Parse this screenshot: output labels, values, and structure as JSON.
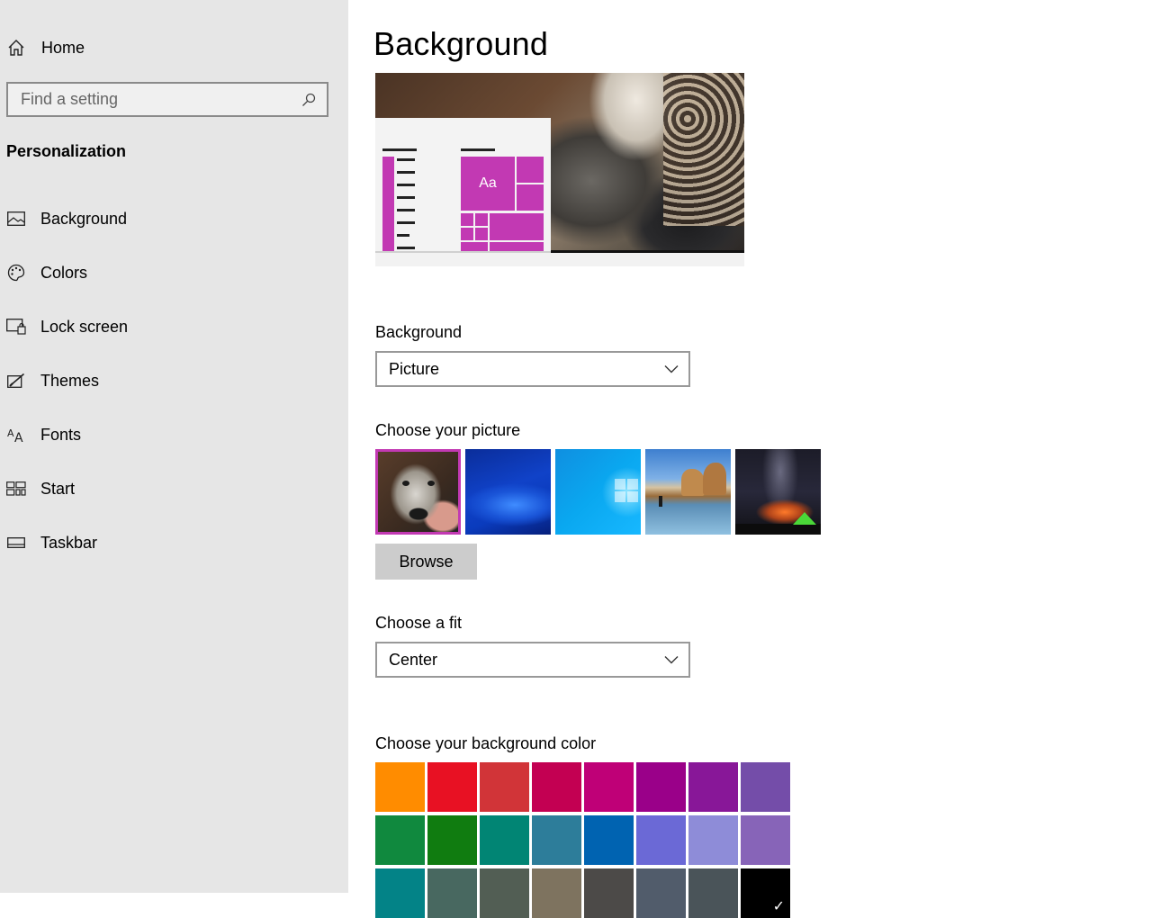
{
  "sidebar": {
    "home_label": "Home",
    "search_placeholder": "Find a setting",
    "section_title": "Personalization",
    "items": [
      {
        "label": "Background",
        "icon": "picture-icon"
      },
      {
        "label": "Colors",
        "icon": "palette-icon"
      },
      {
        "label": "Lock screen",
        "icon": "lock-screen-icon"
      },
      {
        "label": "Themes",
        "icon": "themes-brush-icon"
      },
      {
        "label": "Fonts",
        "icon": "fonts-icon"
      },
      {
        "label": "Start",
        "icon": "start-grid-icon"
      },
      {
        "label": "Taskbar",
        "icon": "taskbar-icon"
      }
    ]
  },
  "main": {
    "title": "Background",
    "preview": {
      "tile_text": "Aa",
      "accent": "#c239b3"
    },
    "background_label": "Background",
    "background_value": "Picture",
    "picture_label": "Choose your picture",
    "pictures": [
      "dog photo",
      "blue waves",
      "windows light",
      "beach rocks",
      "night sky tent"
    ],
    "selected_picture_index": 0,
    "browse_label": "Browse",
    "fit_label": "Choose a fit",
    "fit_value": "Center",
    "color_label": "Choose your background color",
    "colors": [
      [
        "#ff8c00",
        "#e81123",
        "#d13438",
        "#c30052",
        "#bf0077",
        "#9a0089",
        "#881798",
        "#744da9"
      ],
      [
        "#10893e",
        "#107c10",
        "#018574",
        "#2d7d9a",
        "#0063b1",
        "#6b69d6",
        "#8e8cd8",
        "#8764b8"
      ],
      [
        "#038387",
        "#486860",
        "#525e54",
        "#7e735f",
        "#4c4a48",
        "#515c6b",
        "#4a5459",
        "#000000"
      ]
    ],
    "selected_color": "#000000"
  }
}
